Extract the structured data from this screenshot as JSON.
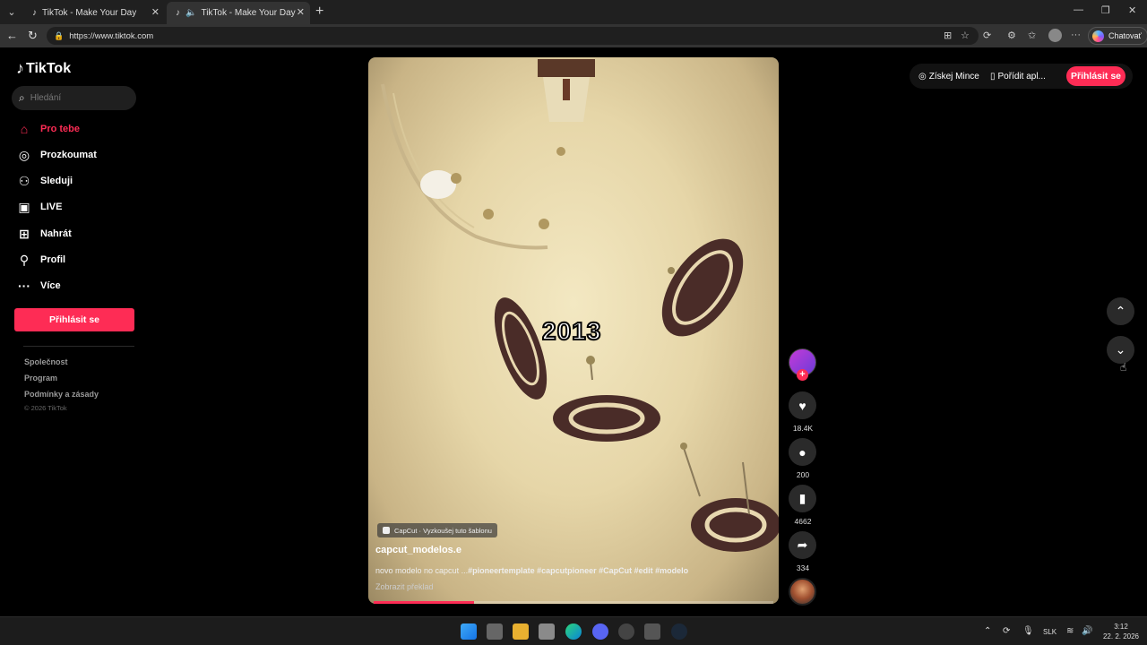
{
  "browser": {
    "tabs": [
      {
        "title": "TikTok - Make Your Day"
      },
      {
        "title": "TikTok - Make Your Day"
      }
    ],
    "url": "https://www.tiktok.com",
    "copilot_label": "Chatovať"
  },
  "sidebar": {
    "logo_text": "TikTok",
    "search_placeholder": "Hledání",
    "nav": [
      {
        "label": "Pro tebe",
        "icon": "home-icon"
      },
      {
        "label": "Prozkoumat",
        "icon": "compass-icon"
      },
      {
        "label": "Sleduji",
        "icon": "following-icon"
      },
      {
        "label": "LIVE",
        "icon": "live-icon"
      },
      {
        "label": "Nahrát",
        "icon": "upload-icon"
      },
      {
        "label": "Profil",
        "icon": "profile-icon"
      },
      {
        "label": "Více",
        "icon": "more-icon"
      }
    ],
    "login_button": "Přihlásit se",
    "footer": [
      "Společnost",
      "Program",
      "Podmínky a zásady"
    ],
    "copyright": "© 2026 TikTok"
  },
  "video": {
    "overlay_year": "2013",
    "template_chip": "CapCut · Vyzkoušej tuto šablonu",
    "author": "capcut_modelos.e",
    "description_plain": "novo modelo no capcut ...",
    "description_tags": "#pioneertemplate #capcutpioneer #CapCut #edit #modelo",
    "translate": "Zobrazit překlad",
    "progress": 0.25
  },
  "actions": {
    "likes": "18.4K",
    "comments": "200",
    "saves": "4662",
    "shares": "334"
  },
  "header": {
    "coins": "Získej Mince",
    "get_app": "Pořídit apl...",
    "login": "Přihlásit se"
  },
  "taskbar": {
    "language": "SLK",
    "time": "3:12",
    "date": "22. 2. 2026"
  },
  "colors": {
    "accent": "#fe2c55",
    "background": "#000000",
    "surface": "#2a2a2a"
  }
}
